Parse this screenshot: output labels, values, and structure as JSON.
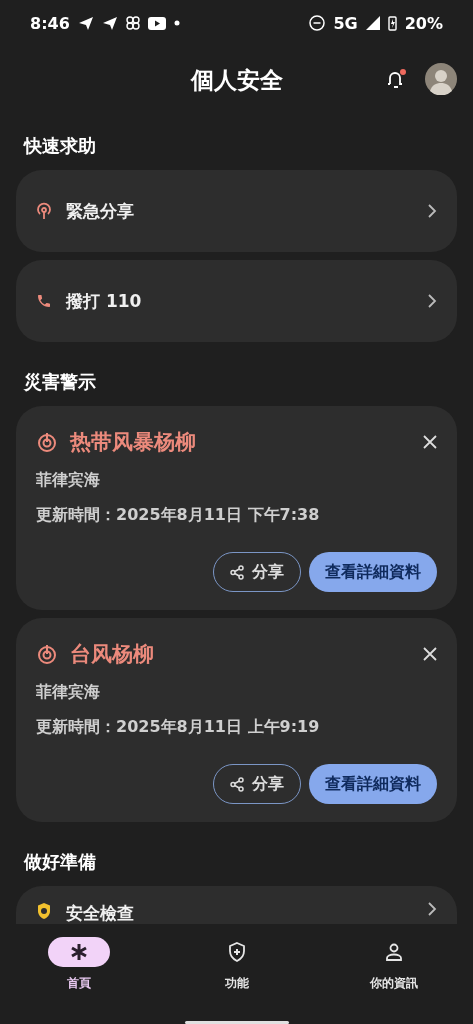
{
  "status_bar": {
    "time": "8:46",
    "network": "5G",
    "battery": "20%"
  },
  "header": {
    "title": "個人安全",
    "notification_dot": true
  },
  "sections": [
    {
      "title": "快速求助",
      "items": [
        {
          "kind": "share",
          "label": "緊急分享"
        },
        {
          "kind": "call",
          "label": "撥打 110"
        }
      ]
    },
    {
      "title": "災害警示",
      "alerts": [
        {
          "title": "热带风暴杨柳",
          "region": "菲律宾海",
          "updated": "更新時間：2025年8月11日 下午7:38",
          "share": "分享",
          "details": "查看詳細資料"
        },
        {
          "title": "台风杨柳",
          "region": "菲律宾海",
          "updated": "更新時間：2025年8月11日 上午9:19",
          "share": "分享",
          "details": "查看詳細資料"
        }
      ]
    },
    {
      "title": "做好準備",
      "items": [
        {
          "kind": "check",
          "label": "安全檢查"
        }
      ]
    }
  ],
  "nav": [
    {
      "kind": "home",
      "label": "首頁",
      "selected": true
    },
    {
      "kind": "features",
      "label": "功能",
      "selected": false
    },
    {
      "kind": "profile",
      "label": "你的資訊",
      "selected": false
    }
  ]
}
